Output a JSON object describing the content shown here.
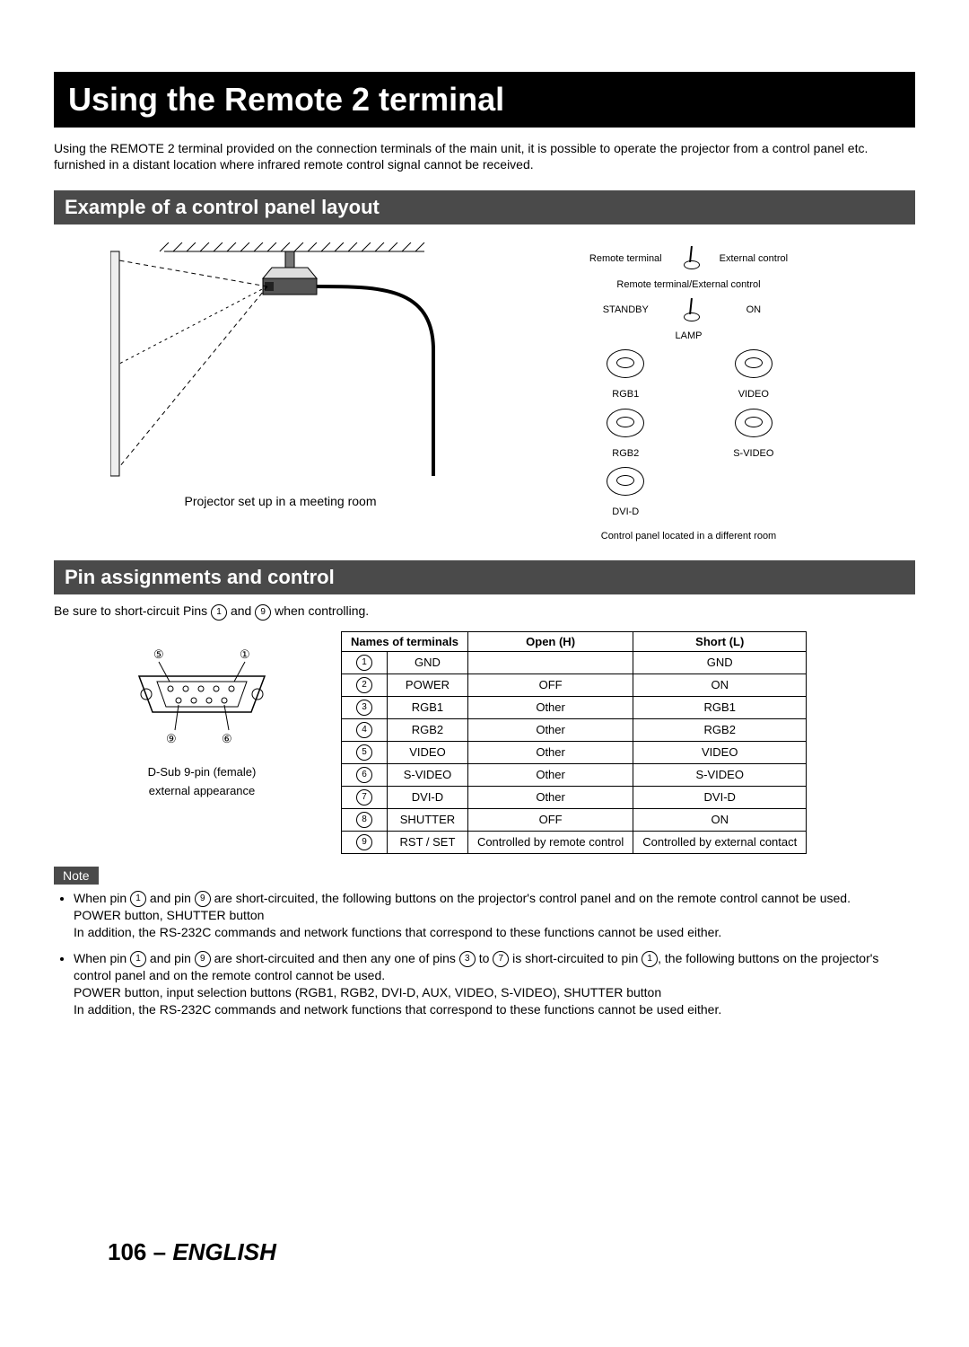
{
  "title": "Using the Remote 2 terminal",
  "intro": "Using the REMOTE 2 terminal provided on the connection terminals of the main unit, it is possible to operate the projector from a control panel etc. furnished in a distant location where infrared remote control signal cannot be received.",
  "section1": "Example of a control panel layout",
  "section2": "Pin assignments and control",
  "example": {
    "left_caption": "Projector set up in a meeting room",
    "right_caption": "Control panel located in a different room",
    "panel": {
      "toggle1_left": "Remote terminal",
      "toggle1_right": "External control",
      "toggle1_sub": "Remote terminal/External control",
      "toggle2_left": "STANDBY",
      "toggle2_right": "ON",
      "toggle2_sub": "LAMP",
      "btn_rgb1": "RGB1",
      "btn_video": "VIDEO",
      "btn_rgb2": "RGB2",
      "btn_svideo": "S-VIDEO",
      "btn_dvid": "DVI-D"
    }
  },
  "pin_intro_a": "Be sure to short-circuit Pins ",
  "pin_intro_b": " and ",
  "pin_intro_c": " when controlling.",
  "pin_intro_p1": "1",
  "pin_intro_p9": "9",
  "dsub_caption1": "D-Sub 9-pin (female)",
  "dsub_caption2": "external appearance",
  "dsub_label5": "5",
  "dsub_label1": "1",
  "dsub_label9": "9",
  "dsub_label6": "6",
  "table_headers": {
    "names": "Names of terminals",
    "open": "Open (H)",
    "short": "Short (L)"
  },
  "pins": [
    {
      "n": "1",
      "name": "GND",
      "open": "",
      "short": "GND"
    },
    {
      "n": "2",
      "name": "POWER",
      "open": "OFF",
      "short": "ON"
    },
    {
      "n": "3",
      "name": "RGB1",
      "open": "Other",
      "short": "RGB1"
    },
    {
      "n": "4",
      "name": "RGB2",
      "open": "Other",
      "short": "RGB2"
    },
    {
      "n": "5",
      "name": "VIDEO",
      "open": "Other",
      "short": "VIDEO"
    },
    {
      "n": "6",
      "name": "S-VIDEO",
      "open": "Other",
      "short": "S-VIDEO"
    },
    {
      "n": "7",
      "name": "DVI-D",
      "open": "Other",
      "short": "DVI-D"
    },
    {
      "n": "8",
      "name": "SHUTTER",
      "open": "OFF",
      "short": "ON"
    },
    {
      "n": "9",
      "name": "RST / SET",
      "open": "Controlled by remote control",
      "short": "Controlled by external contact"
    }
  ],
  "note_label": "Note",
  "notes": {
    "n1a": "When pin ",
    "n1b": " and pin ",
    "n1c": " are short-circuited, the following buttons on the projector's control panel and on the remote control cannot be used.",
    "n1d": "POWER button, SHUTTER button",
    "n1e": "In addition, the RS-232C commands and network functions that correspond to these functions cannot be used either.",
    "n2a": "When pin ",
    "n2b": " and pin ",
    "n2c": " are short-circuited and then any one of pins ",
    "n2d": " to ",
    "n2e": " is short-circuited to pin ",
    "n2f": ", the following buttons on the projector's control panel and on the remote control cannot be used.",
    "n2g": "POWER button, input selection buttons (RGB1, RGB2, DVI-D, AUX, VIDEO, S-VIDEO), SHUTTER button",
    "n2h": "In addition, the RS-232C commands and network functions that correspond to these functions cannot be used either.",
    "p1": "1",
    "p9": "9",
    "p3": "3",
    "p7": "7"
  },
  "footer_page": "106",
  "footer_sep": " – ",
  "footer_lang": "ENGLISH"
}
